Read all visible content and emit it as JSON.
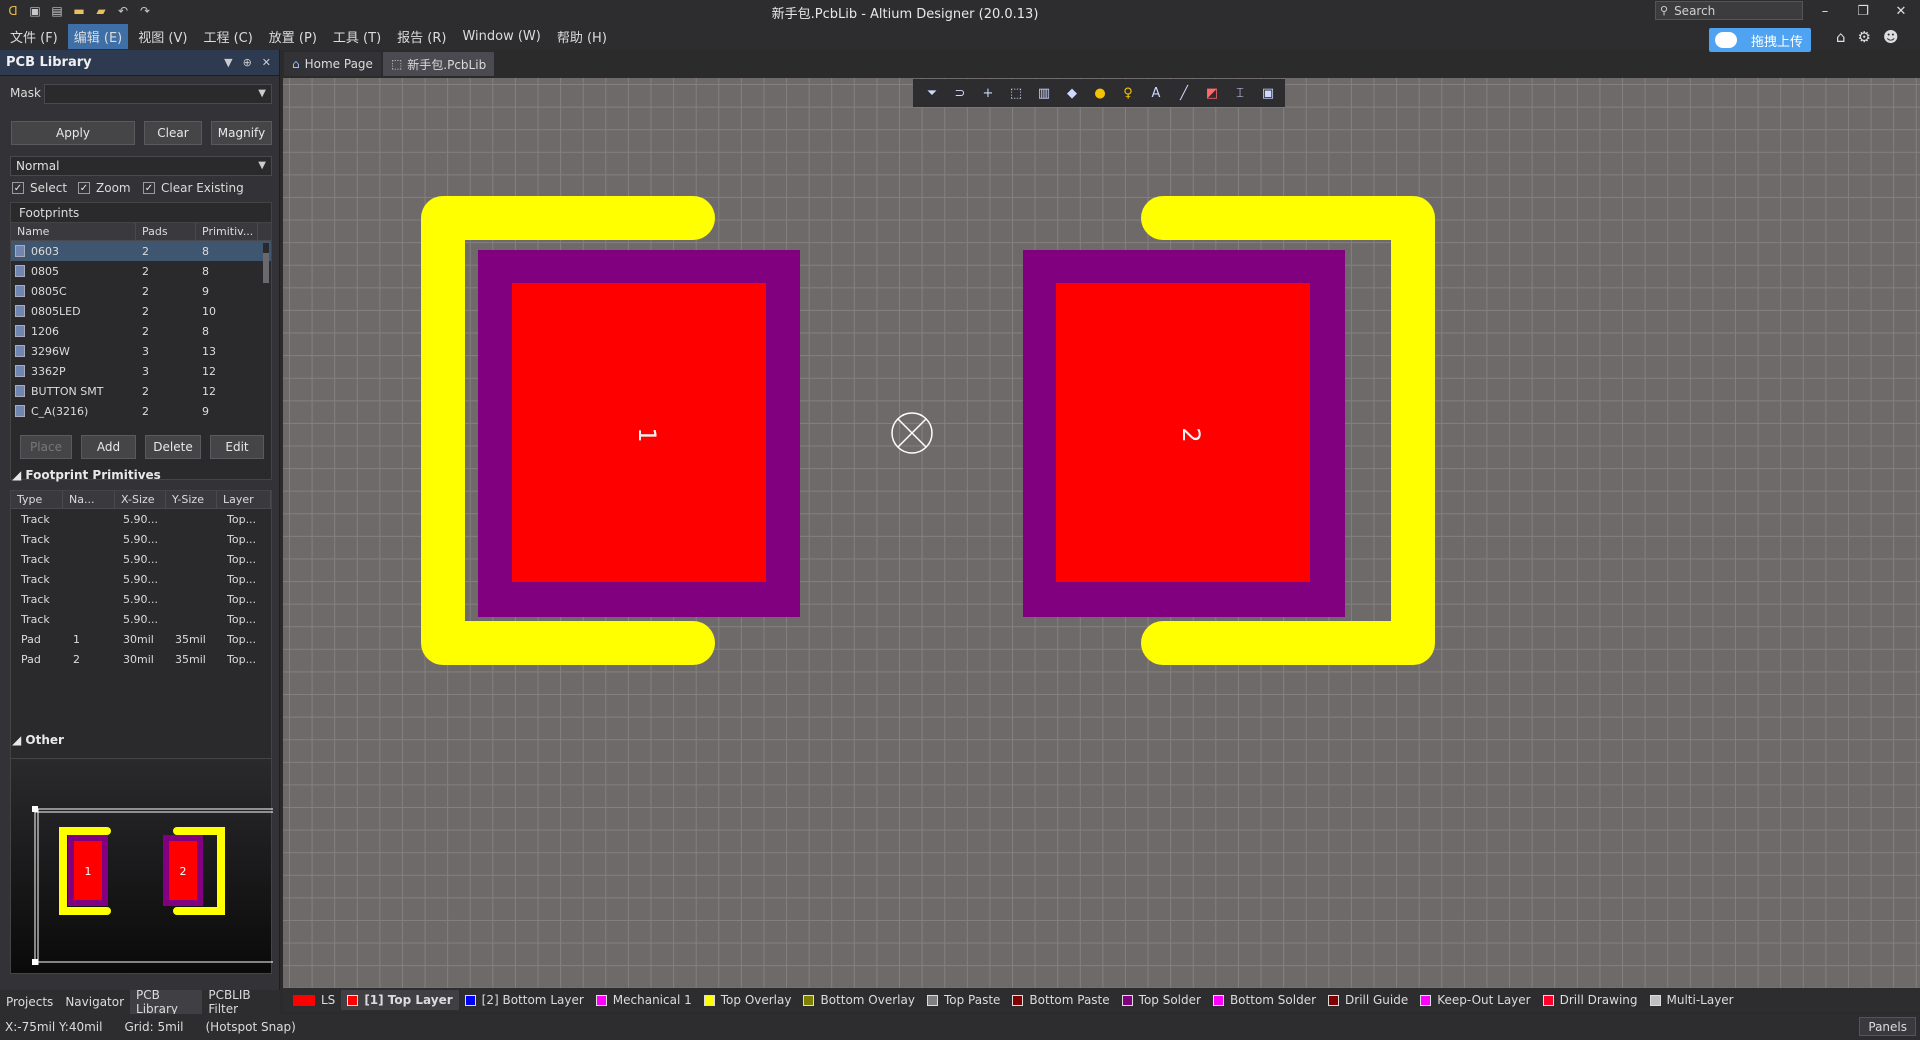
{
  "window": {
    "title": "新手包.PcbLib - Altium Designer (20.0.13)",
    "search_placeholder": "Search",
    "minimize": "–",
    "restore": "❐",
    "close": "✕"
  },
  "menu": [
    "文件 (F)",
    "编辑 (E)",
    "视图 (V)",
    "工程 (C)",
    "放置 (P)",
    "工具 (T)",
    "报告 (R)",
    "Window (W)",
    "帮助 (H)"
  ],
  "upload_button": "拖拽上传",
  "panel": {
    "title": "PCB Library",
    "mask_label": "Mask",
    "mask_value": "",
    "apply": "Apply",
    "clear": "Clear",
    "magnify": "Magnify",
    "mode": "Normal",
    "select": "Select",
    "zoom": "Zoom",
    "clear_existing": "Clear Existing",
    "footprints_title": "Footprints",
    "fp_headers": [
      "Name",
      "Pads",
      "Primitiv..."
    ],
    "footprints": [
      {
        "name": "0603",
        "pads": "2",
        "prims": "8"
      },
      {
        "name": "0805",
        "pads": "2",
        "prims": "8"
      },
      {
        "name": "0805C",
        "pads": "2",
        "prims": "9"
      },
      {
        "name": "0805LED",
        "pads": "2",
        "prims": "10"
      },
      {
        "name": "1206",
        "pads": "2",
        "prims": "8"
      },
      {
        "name": "3296W",
        "pads": "3",
        "prims": "13"
      },
      {
        "name": "3362P",
        "pads": "3",
        "prims": "12"
      },
      {
        "name": "BUTTON SMT",
        "pads": "2",
        "prims": "12"
      },
      {
        "name": "C_A(3216)",
        "pads": "2",
        "prims": "9"
      }
    ],
    "place": "Place",
    "add": "Add",
    "delete": "Delete",
    "edit": "Edit",
    "primitives_title": "Footprint Primitives",
    "prim_headers": [
      "Type",
      "Na...",
      "X-Size",
      "Y-Size",
      "Layer"
    ],
    "primitives": [
      {
        "type": "Track",
        "name": "",
        "x": "5.90...",
        "y": "",
        "layer": "Top..."
      },
      {
        "type": "Track",
        "name": "",
        "x": "5.90...",
        "y": "",
        "layer": "Top..."
      },
      {
        "type": "Track",
        "name": "",
        "x": "5.90...",
        "y": "",
        "layer": "Top..."
      },
      {
        "type": "Track",
        "name": "",
        "x": "5.90...",
        "y": "",
        "layer": "Top..."
      },
      {
        "type": "Track",
        "name": "",
        "x": "5.90...",
        "y": "",
        "layer": "Top..."
      },
      {
        "type": "Track",
        "name": "",
        "x": "5.90...",
        "y": "",
        "layer": "Top..."
      },
      {
        "type": "Pad",
        "name": "1",
        "x": "30mil",
        "y": "35mil",
        "layer": "Top..."
      },
      {
        "type": "Pad",
        "name": "2",
        "x": "30mil",
        "y": "35mil",
        "layer": "Top..."
      }
    ],
    "other_title": "Other",
    "preview_pads": [
      "1",
      "2"
    ]
  },
  "panel_tabs": [
    "Projects",
    "Navigator",
    "PCB Library",
    "PCBLIB Filter"
  ],
  "doc_tabs": [
    "Home Page",
    "新手包.PcbLib"
  ],
  "canvas": {
    "pad1_label": "1",
    "pad2_label": "2"
  },
  "layers": [
    {
      "label": "LS",
      "color": "#ff0000"
    },
    {
      "label": "[1] Top Layer",
      "color": "#ff0000"
    },
    {
      "label": "[2] Bottom Layer",
      "color": "#0000ff"
    },
    {
      "label": "Mechanical 1",
      "color": "#ff00ff"
    },
    {
      "label": "Top Overlay",
      "color": "#ffff00"
    },
    {
      "label": "Bottom Overlay",
      "color": "#808000"
    },
    {
      "label": "Top Paste",
      "color": "#808080"
    },
    {
      "label": "Bottom Paste",
      "color": "#800000"
    },
    {
      "label": "Top Solder",
      "color": "#800080"
    },
    {
      "label": "Bottom Solder",
      "color": "#ff00ff"
    },
    {
      "label": "Drill Guide",
      "color": "#800000"
    },
    {
      "label": "Keep-Out Layer",
      "color": "#ff00ff"
    },
    {
      "label": "Drill Drawing",
      "color": "#ff002a"
    },
    {
      "label": "Multi-Layer",
      "color": "#c0c0c0"
    }
  ],
  "status": {
    "coords": "X:-75mil Y:40mil",
    "grid": "Grid: 5mil",
    "snap": "(Hotspot Snap)",
    "panels": "Panels"
  },
  "colors": {
    "overlay": "#ffff00",
    "solder": "#800080",
    "copper": "#ff0000",
    "canvas": "#6f6a6a"
  }
}
